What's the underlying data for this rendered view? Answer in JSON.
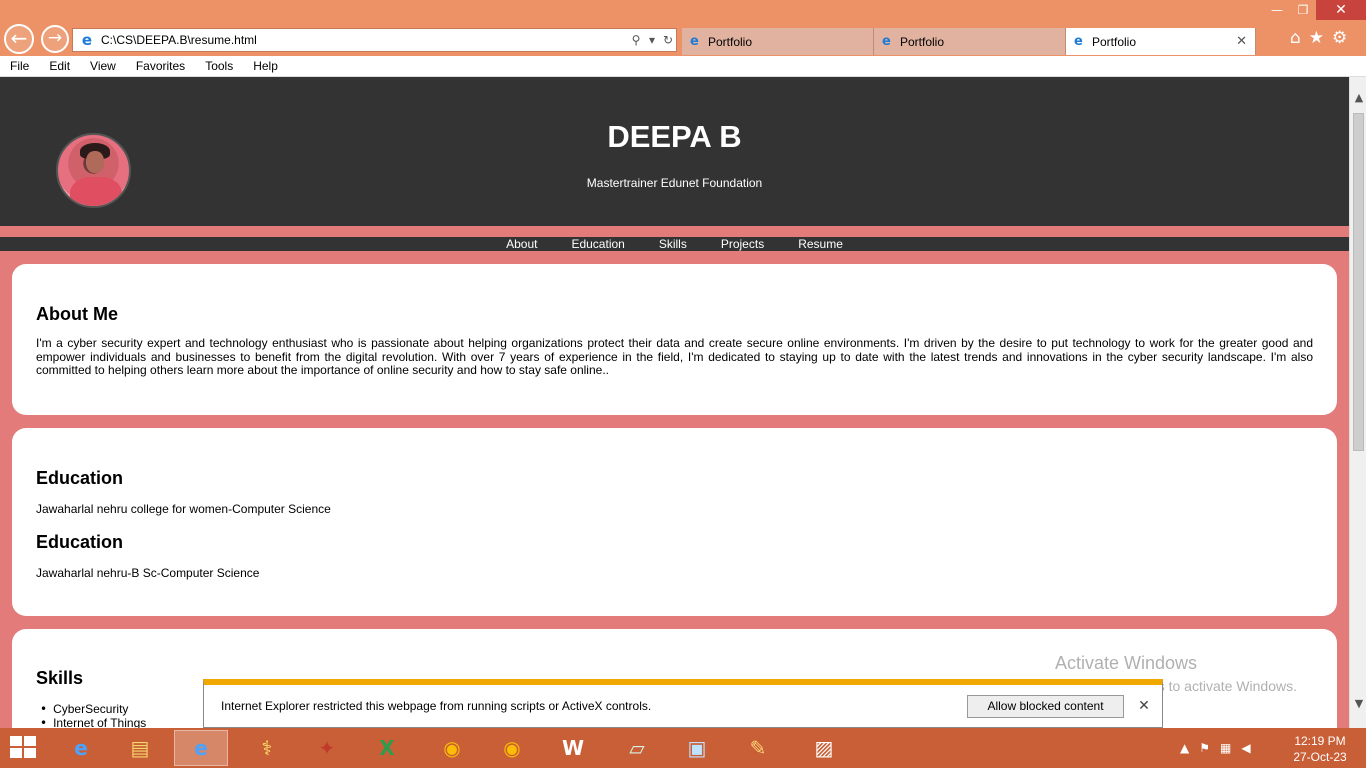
{
  "browser": {
    "address_url": "C:\\CS\\DEEPA.B\\resume.html",
    "tabs": [
      {
        "label": "Portfolio",
        "active": false
      },
      {
        "label": "Portfolio",
        "active": false
      },
      {
        "label": "Portfolio",
        "active": true
      }
    ],
    "menu": [
      "File",
      "Edit",
      "View",
      "Favorites",
      "Tools",
      "Help"
    ]
  },
  "site": {
    "name": "DEEPA B",
    "subtitle": "Mastertrainer Edunet Foundation",
    "nav": [
      "About",
      "Education",
      "Skills",
      "Projects",
      "Resume"
    ]
  },
  "about": {
    "heading": "About Me",
    "text": "I'm a cyber security expert and technology enthusiast who is passionate about helping organizations protect their data and create secure online environments. I'm driven by the desire to put technology to work for the greater good and empower individuals and businesses to benefit from the digital revolution. With over 7 years of experience in the field, I'm dedicated to staying up to date with the latest trends and innovations in the cyber security landscape. I'm also committed to helping others learn more about the importance of online security and how to stay safe online.."
  },
  "education": [
    {
      "heading": "Education",
      "text": "Jawaharlal nehru college for women-Computer Science"
    },
    {
      "heading": "Education",
      "text": "Jawaharlal nehru-B Sc-Computer Science"
    }
  ],
  "skills": {
    "heading": "Skills",
    "items": [
      "CyberSecurity",
      "Internet of Things"
    ]
  },
  "watermark": {
    "line1": "Activate Windows",
    "line2": "Go to PC settings to activate Windows."
  },
  "notification": {
    "message": "Internet Explorer restricted this webpage from running scripts or ActiveX controls.",
    "button": "Allow blocked content"
  },
  "taskbar": {
    "time": "12:19 PM",
    "date": "27-Oct-23"
  },
  "colors": {
    "page_background": "#e37b7b",
    "header_dark": "#333333",
    "titlebar": "#ec9266",
    "taskbar": "#c85f36"
  }
}
